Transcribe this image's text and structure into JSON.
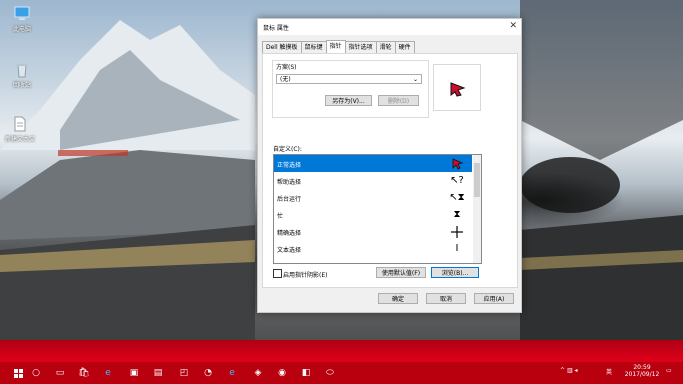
{
  "desktop": {
    "icons": [
      {
        "label": "此电脑",
        "icon": "pc-icon"
      },
      {
        "label": "回收站",
        "icon": "recycle-bin-icon"
      },
      {
        "label": "新建文本文",
        "icon": "text-file-icon"
      }
    ]
  },
  "dialog": {
    "title": "鼠标 属性",
    "tabs": [
      "Dell 触摸板",
      "鼠标键",
      "指针",
      "指针选项",
      "滑轮",
      "硬件"
    ],
    "active_tab": "指针",
    "scheme": {
      "label": "方案(S)",
      "value": "(无)",
      "save_as": "另存为(V)...",
      "delete": "删除(D)"
    },
    "customize_label": "自定义(C):",
    "cursor_list": [
      {
        "name": "正常选择",
        "icon": "arrow-cursor-icon",
        "selected": true
      },
      {
        "name": "帮助选择",
        "icon": "help-cursor-icon",
        "selected": false
      },
      {
        "name": "后台运行",
        "icon": "working-cursor-icon",
        "selected": false
      },
      {
        "name": "忙",
        "icon": "busy-cursor-icon",
        "selected": false
      },
      {
        "name": "精确选择",
        "icon": "crosshair-cursor-icon",
        "selected": false
      },
      {
        "name": "文本选择",
        "icon": "text-cursor-icon",
        "selected": false
      }
    ],
    "shadow_label": "启用指针阴影(E)",
    "use_default": "使用默认值(F)",
    "browse": "浏览(B)...",
    "ok": "确定",
    "cancel": "取消",
    "apply": "应用(A)"
  },
  "taskbar": {
    "time": "20:59",
    "date": "2017/09/12",
    "ime": "英",
    "accent": "#b8000f"
  }
}
